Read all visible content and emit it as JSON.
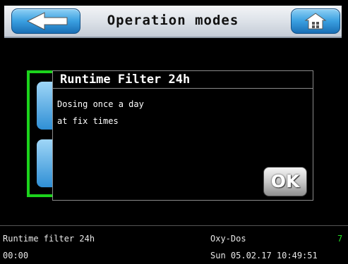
{
  "header": {
    "title": "Operation modes"
  },
  "dialog": {
    "title": "Runtime Filter 24h",
    "lines": [
      "Dosing once a day",
      "at fix times"
    ],
    "ok_label": "OK"
  },
  "status": {
    "mode": "Runtime filter 24h",
    "timer": "00:00",
    "device": "Oxy-Dos",
    "indicator": "7",
    "datetime": "Sun 05.02.17 10:49:51"
  },
  "colors": {
    "accent_blue": "#3a9fe0",
    "green_outline": "#1cd31c",
    "status_green": "#22dd22"
  }
}
